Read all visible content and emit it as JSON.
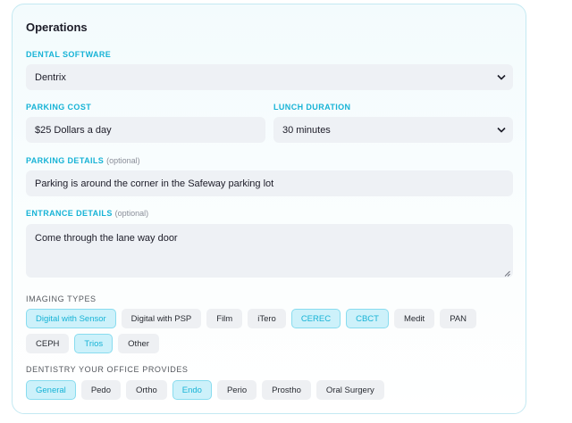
{
  "title": "Operations",
  "dental_software": {
    "label": "DENTAL SOFTWARE",
    "value": "Dentrix"
  },
  "parking_cost": {
    "label": "PARKING COST",
    "value": "$25 Dollars a day"
  },
  "lunch_duration": {
    "label": "LUNCH DURATION",
    "value": "30 minutes"
  },
  "parking_details": {
    "label": "PARKING DETAILS",
    "optional": "(optional)",
    "value": "Parking is around the corner in the Safeway parking lot"
  },
  "entrance_details": {
    "label": "ENTRANCE DETAILS",
    "optional": "(optional)",
    "value": "Come through the lane way door"
  },
  "imaging_types": {
    "label": "IMAGING TYPES",
    "options": [
      {
        "label": "Digital with Sensor",
        "selected": true
      },
      {
        "label": "Digital with PSP",
        "selected": false
      },
      {
        "label": "Film",
        "selected": false
      },
      {
        "label": "iTero",
        "selected": false
      },
      {
        "label": "CEREC",
        "selected": true
      },
      {
        "label": "CBCT",
        "selected": true
      },
      {
        "label": "Medit",
        "selected": false
      },
      {
        "label": "PAN",
        "selected": false
      },
      {
        "label": "CEPH",
        "selected": false
      },
      {
        "label": "Trios",
        "selected": true
      },
      {
        "label": "Other",
        "selected": false
      }
    ]
  },
  "dentistry": {
    "label": "DENTISTRY YOUR OFFICE PROVIDES",
    "options": [
      {
        "label": "General",
        "selected": true
      },
      {
        "label": "Pedo",
        "selected": false
      },
      {
        "label": "Ortho",
        "selected": false
      },
      {
        "label": "Endo",
        "selected": true
      },
      {
        "label": "Perio",
        "selected": false
      },
      {
        "label": "Prostho",
        "selected": false
      },
      {
        "label": "Oral Surgery",
        "selected": false
      }
    ]
  },
  "icons": {
    "select_arrow": "chevron-down-icon",
    "resize": "resize-handle-icon"
  },
  "colors": {
    "accent": "#17b3d6",
    "chip_selected_bg": "#cdf1fa",
    "chip_selected_border": "#88dcef",
    "field_bg": "#eef1f5",
    "card_border": "#c4e9f2"
  }
}
